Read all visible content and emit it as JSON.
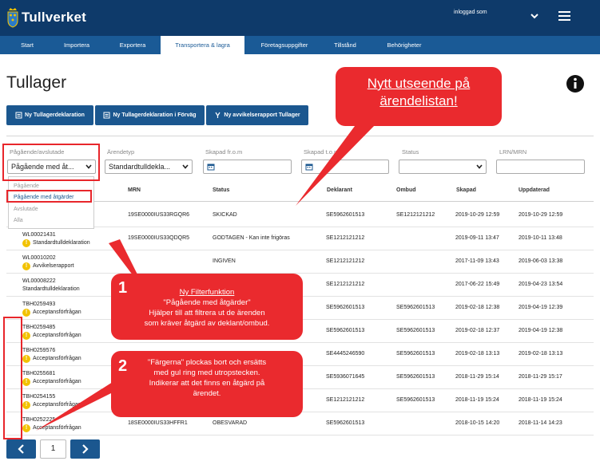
{
  "header": {
    "brand": "Tullverket",
    "user_label": "inloggad som"
  },
  "nav": [
    "Start",
    "Importera",
    "Exportera",
    "Transportera & lagra",
    "Företagsuppgifter",
    "Tillstånd",
    "Behörigheter"
  ],
  "page": {
    "title": "Tullager"
  },
  "buttons": {
    "new_declaration": "Ny Tullagerdeklaration",
    "new_declaration_advance": "Ny Tullagerdeklaration i Förväg",
    "new_deviation": "Ny avvikelserapport Tullager"
  },
  "filters": {
    "status_group": {
      "label": "Pågående/avslutade",
      "value": "Pågående med åt..."
    },
    "case_type": {
      "label": "Ärendetyp",
      "value": "Standardtulldekla..."
    },
    "created_from": {
      "label": "Skapad fr.o.m"
    },
    "created_to": {
      "label": "Skapad t.o.m"
    },
    "status": {
      "label": "Status"
    },
    "lrn_mrn": {
      "label": "LRN/MRN"
    },
    "dropdown_options": [
      "Pågående",
      "Pågående med åtgärder",
      "Avslutade",
      "Alla"
    ]
  },
  "table": {
    "headers": [
      "MRN",
      "Status",
      "Deklarant",
      "Ombud",
      "Skapad",
      "Uppdaterad"
    ],
    "rows": [
      {
        "id": "",
        "type": "",
        "mrn": "19SE0000IUS33RGQR6",
        "status": "SKICKAD",
        "deklarant": "SE5962601513",
        "ombud": "SE1212121212",
        "skapad": "2019-10-29 12:59",
        "uppdaterad": "2019-10-29 12:59",
        "warn": false
      },
      {
        "id": "WL00021431",
        "type": "Standardtulldeklaration",
        "mrn": "19SE0000IUS33QDQR5",
        "status": "GODTAGEN - Kan inte frigöras",
        "deklarant": "SE1212121212",
        "ombud": "",
        "skapad": "2019-09-11 13:47",
        "uppdaterad": "2019-10-11 13:48",
        "warn": true
      },
      {
        "id": "WL00010202",
        "type": "Avvikelserapport",
        "mrn": "",
        "status": "INGIVEN",
        "deklarant": "SE1212121212",
        "ombud": "",
        "skapad": "2017-11-09 13:43",
        "uppdaterad": "2019-06-03 13:38",
        "warn": true
      },
      {
        "id": "WL00008222",
        "type": "Standardtulldeklaration",
        "mrn": "",
        "status": "",
        "deklarant": "SE1212121212",
        "ombud": "",
        "skapad": "2017-06-22 15:49",
        "uppdaterad": "2019-04-23 13:54",
        "warn": false
      },
      {
        "id": "TBH0259493",
        "type": "Acceptansförfrågan",
        "mrn": "",
        "status": "",
        "deklarant": "SE5962601513",
        "ombud": "SE5962601513",
        "skapad": "2019-02-18 12:38",
        "uppdaterad": "2019-04-19 12:39",
        "warn": true
      },
      {
        "id": "TBH0259485",
        "type": "Acceptansförfrågan",
        "mrn": "",
        "status": "",
        "deklarant": "SE5962601513",
        "ombud": "SE5962601513",
        "skapad": "2019-02-18 12:37",
        "uppdaterad": "2019-04-19 12:38",
        "warn": true
      },
      {
        "id": "TBH0259576",
        "type": "Acceptansförfrågan",
        "mrn": "",
        "status": "",
        "deklarant": "SE4445246590",
        "ombud": "SE5962601513",
        "skapad": "2019-02-18 13:13",
        "uppdaterad": "2019-02-18 13:13",
        "warn": true
      },
      {
        "id": "TBH0255681",
        "type": "Acceptansförfrågan",
        "mrn": "",
        "status": "",
        "deklarant": "SE5936071645",
        "ombud": "SE5962601513",
        "skapad": "2018-11-29 15:14",
        "uppdaterad": "2018-11-29 15:17",
        "warn": true
      },
      {
        "id": "TBH0254155",
        "type": "Acceptansförfrågan",
        "mrn": "",
        "status": "",
        "deklarant": "SE1212121212",
        "ombud": "SE5962601513",
        "skapad": "2018-11-19 15:24",
        "uppdaterad": "2018-11-19 15:24",
        "warn": true
      },
      {
        "id": "TBH0252225",
        "type": "Acceptansförfrågan",
        "mrn": "18SE0000IUS33HFFR1",
        "status": "OBESVARAD",
        "deklarant": "SE5962601513",
        "ombud": "",
        "skapad": "2018-10-15 14:20",
        "uppdaterad": "2018-11-14 14:23",
        "warn": true
      }
    ]
  },
  "pagination": {
    "page": "1"
  },
  "annotations": {
    "big": {
      "line1": "Nytt utseende på",
      "line2": "ärendelistan!"
    },
    "callout1": {
      "num": "1",
      "title": "Ny Filterfunktion",
      "quote": "\"Pågående med åtgärder\"",
      "line1": "Hjälper till att filtrera ut de ärenden",
      "line2": "som kräver åtgärd av deklant/ombud."
    },
    "callout2": {
      "num": "2",
      "line1": "\"Färgerna\" plockas bort och ersätts",
      "line2": "med gul ring med utropstecken.",
      "line3": "Indikerar att det finns en åtgärd på",
      "line4": "ärendet."
    }
  },
  "colors": {
    "header": "#0e3a6a",
    "nav": "#1a5a96",
    "button": "#1b578f",
    "annotation": "#ea2a2e",
    "warning": "#f2c200"
  }
}
